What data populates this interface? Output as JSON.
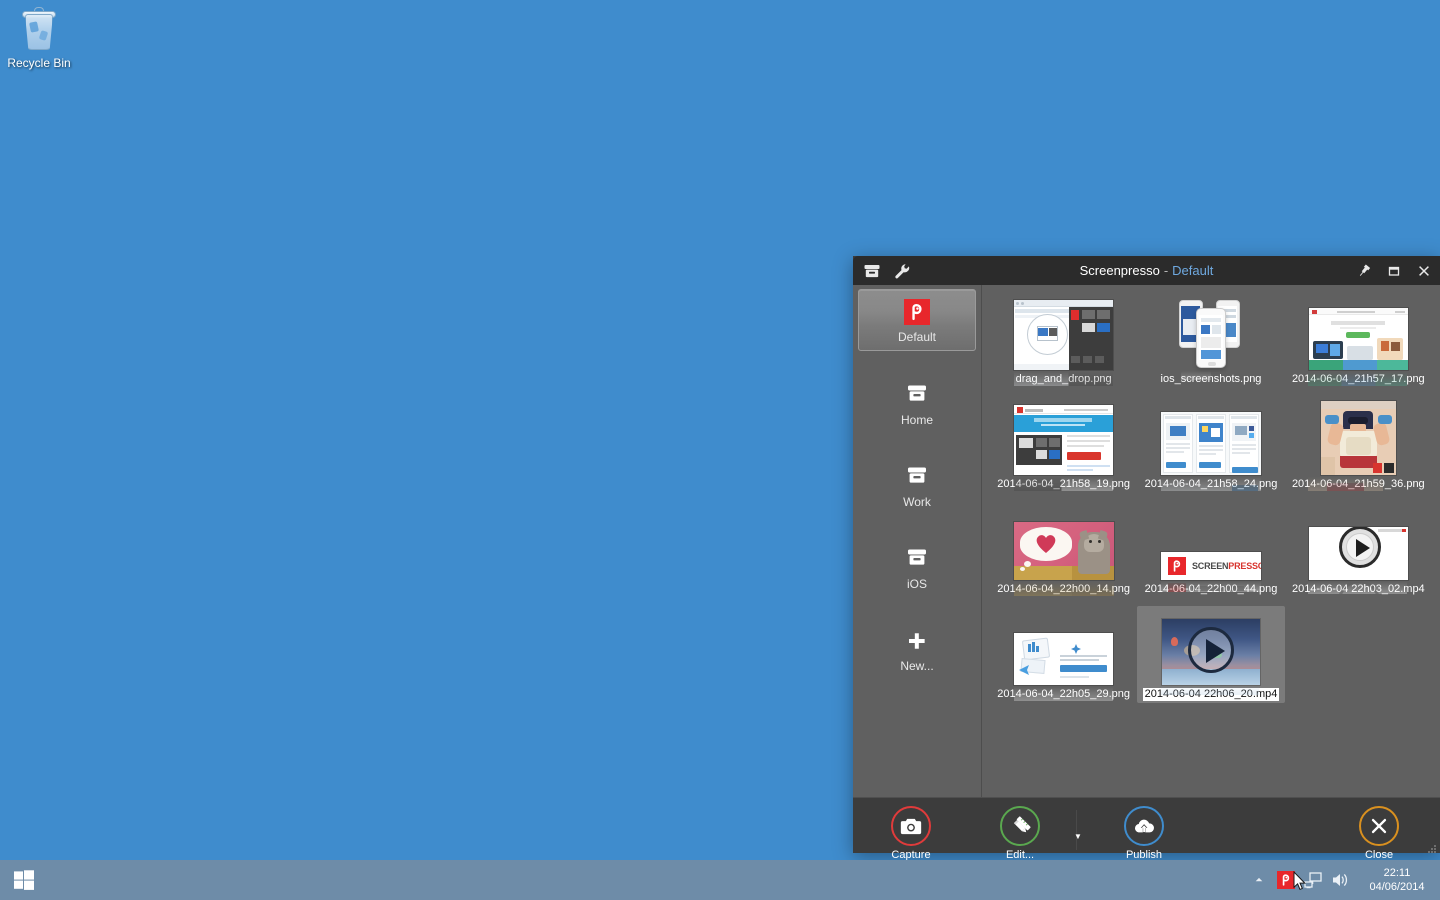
{
  "desktop": {
    "background_color": "#3f8ccd",
    "icons": [
      {
        "name": "recycle-bin",
        "label": "Recycle Bin"
      }
    ]
  },
  "window": {
    "titlebar": {
      "app_name": "Screenpresso",
      "separator": "-",
      "folder_name": "Default",
      "left_icons": [
        {
          "name": "archive-box-icon",
          "tooltip": "Workspace"
        },
        {
          "name": "wrench-icon",
          "tooltip": "Tools"
        }
      ],
      "controls": [
        {
          "name": "pin-icon",
          "label": "Pin"
        },
        {
          "name": "restore-icon",
          "label": "Restore"
        },
        {
          "name": "close-icon",
          "label": "Close"
        }
      ]
    },
    "sidebar": {
      "items": [
        {
          "label": "Default",
          "icon": "screenpresso-logo-icon",
          "selected": true
        },
        {
          "label": "Home",
          "icon": "folder-icon",
          "selected": false
        },
        {
          "label": "Work",
          "icon": "folder-icon",
          "selected": false
        },
        {
          "label": "iOS",
          "icon": "folder-icon",
          "selected": false
        },
        {
          "label": "New...",
          "icon": "plus-icon",
          "selected": false
        }
      ]
    },
    "thumbnails": [
      {
        "label": "drag_and_drop.png",
        "kind": "image",
        "art": "drag-drop",
        "selected": false
      },
      {
        "label": "ios_screenshots.png",
        "kind": "image",
        "art": "ios-phones",
        "selected": false
      },
      {
        "label": "2014-06-04_21h57_17.png",
        "kind": "image",
        "art": "web-page-green",
        "selected": false
      },
      {
        "label": "2014-06-04_21h58_19.png",
        "kind": "image",
        "art": "web-page-blue",
        "selected": false
      },
      {
        "label": "2014-06-04_21h58_24.png",
        "kind": "image",
        "art": "three-columns",
        "selected": false
      },
      {
        "label": "2014-06-04_21h59_36.png",
        "kind": "image",
        "art": "superhero-kid",
        "selected": false
      },
      {
        "label": "2014-06-04_22h00_14.png",
        "kind": "image",
        "art": "cat-heart",
        "selected": false
      },
      {
        "label": "2014-06-04_22h00_44.png",
        "kind": "image",
        "art": "screenpresso-banner",
        "selected": false
      },
      {
        "label": "2014-06-04 22h03_02.mp4",
        "kind": "video",
        "art": "video-white",
        "selected": false
      },
      {
        "label": "2014-06-04_22h05_29.png",
        "kind": "image",
        "art": "dropbox-upload",
        "selected": false
      },
      {
        "label": "2014-06-04 22h06_20.mp4",
        "kind": "video",
        "art": "video-sky",
        "selected": true
      }
    ],
    "toolbar": {
      "buttons": [
        {
          "label": "Capture",
          "icon": "camera-icon",
          "accent": "#e03b3b"
        },
        {
          "label": "Edit...",
          "icon": "pencil-ruler-icon",
          "accent": "#5aa84f"
        },
        {
          "label": "Publish",
          "icon": "cloud-upload-icon",
          "accent": "#3f8ccd"
        },
        {
          "label": "Close",
          "icon": "close-x-icon",
          "accent": "#d9901f"
        }
      ],
      "dropdown": {
        "name": "edit-dropdown",
        "glyph": "▼"
      }
    }
  },
  "taskbar": {
    "start": {
      "name": "start-button",
      "label": "Start"
    },
    "tray": [
      {
        "name": "show-hidden-icons",
        "glyph": "▲"
      },
      {
        "name": "screenpresso-tray-icon"
      },
      {
        "name": "network-icon"
      },
      {
        "name": "volume-icon"
      }
    ],
    "clock": {
      "time": "22:11",
      "date": "04/06/2014"
    }
  }
}
